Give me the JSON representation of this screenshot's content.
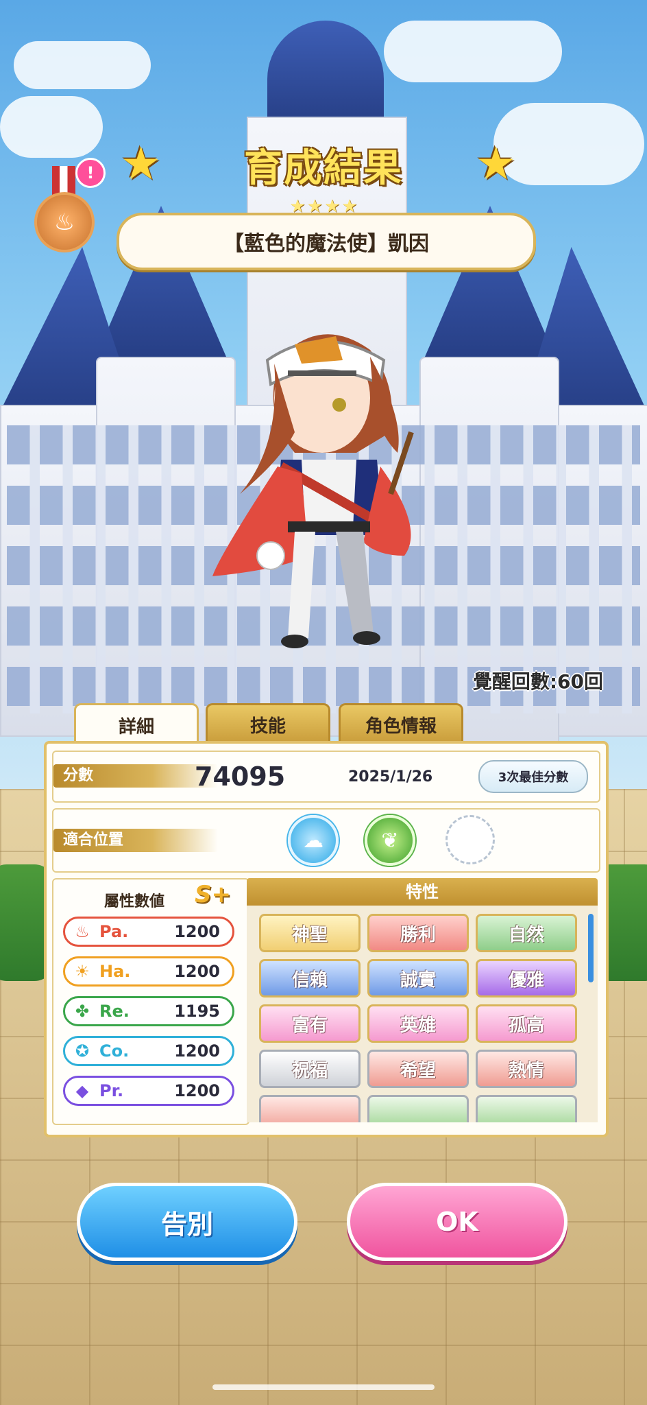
{
  "header": {
    "title": "育成結果",
    "rarity_stars": "★★★★",
    "character_name": "【藍色的魔法使】凱因",
    "alert_badge": "!"
  },
  "awakening": "覺醒回數:60回",
  "tabs": [
    {
      "label": "詳細"
    },
    {
      "label": "技能"
    },
    {
      "label": "角色情報"
    }
  ],
  "score": {
    "label": "分數",
    "value": "74095",
    "date": "2025/1/26",
    "best_button": "3次最佳分數"
  },
  "position": {
    "label": "適合位置",
    "icons": [
      "cloud-position-icon",
      "leaf-position-icon",
      "empty-slot"
    ]
  },
  "attributes": {
    "title": "屬性數値",
    "rank": "S+",
    "items": [
      {
        "name": "Pa.",
        "value": "1200",
        "icon": "flame-icon",
        "color": "#e5533d"
      },
      {
        "name": "Ha.",
        "value": "1200",
        "icon": "sun-icon",
        "color": "#f0a020"
      },
      {
        "name": "Re.",
        "value": "1195",
        "icon": "clover-icon",
        "color": "#3aa64a"
      },
      {
        "name": "Co.",
        "value": "1200",
        "icon": "swirl-icon",
        "color": "#2fb0d8"
      },
      {
        "name": "Pr.",
        "value": "1200",
        "icon": "diamond-icon",
        "color": "#7a4fe0"
      }
    ]
  },
  "traits": {
    "title": "特性",
    "items": [
      {
        "label": "神聖",
        "style": "gold"
      },
      {
        "label": "勝利",
        "style": "red"
      },
      {
        "label": "自然",
        "style": "green"
      },
      {
        "label": "信賴",
        "style": "blue"
      },
      {
        "label": "誠實",
        "style": "blue"
      },
      {
        "label": "優雅",
        "style": "purple"
      },
      {
        "label": "富有",
        "style": "pink"
      },
      {
        "label": "英雄",
        "style": "pink"
      },
      {
        "label": "孤高",
        "style": "pink"
      },
      {
        "label": "祝福",
        "style": "silver"
      },
      {
        "label": "希望",
        "style": "silver-red"
      },
      {
        "label": "熱情",
        "style": "silver-red"
      }
    ]
  },
  "buttons": {
    "farewell": "告別",
    "ok": "OK"
  }
}
